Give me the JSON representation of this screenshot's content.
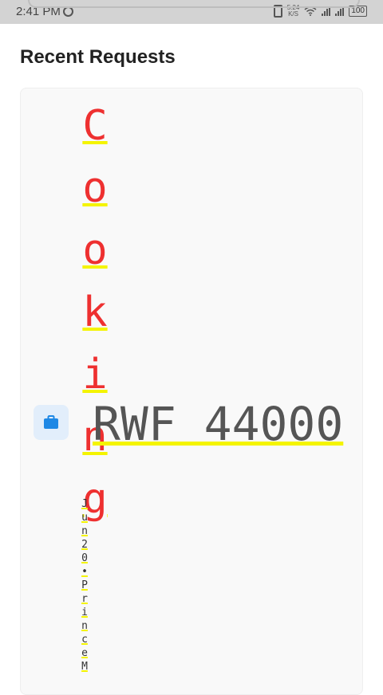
{
  "status_bar": {
    "time": "2:41 PM",
    "speed_value": "5.24",
    "speed_unit": "K/S",
    "battery": "100"
  },
  "page": {
    "title": "Recent Requests"
  },
  "request": {
    "category": "Cooking",
    "category_chars": [
      "C",
      "o",
      "o",
      "k",
      "i",
      "n",
      "g"
    ],
    "amount": "RWF 44000",
    "meta": "Jun20•PrinceM",
    "meta_chars": [
      "J",
      "u",
      "n",
      "2",
      "0",
      "•",
      "P",
      "r",
      "i",
      "n",
      "c",
      "e",
      "M"
    ],
    "icon": "briefcase-icon",
    "colors": {
      "category": "#ee3030",
      "highlight": "#f4f400",
      "icon": "#1e88e5",
      "icon_bg": "#e2eefb"
    }
  }
}
